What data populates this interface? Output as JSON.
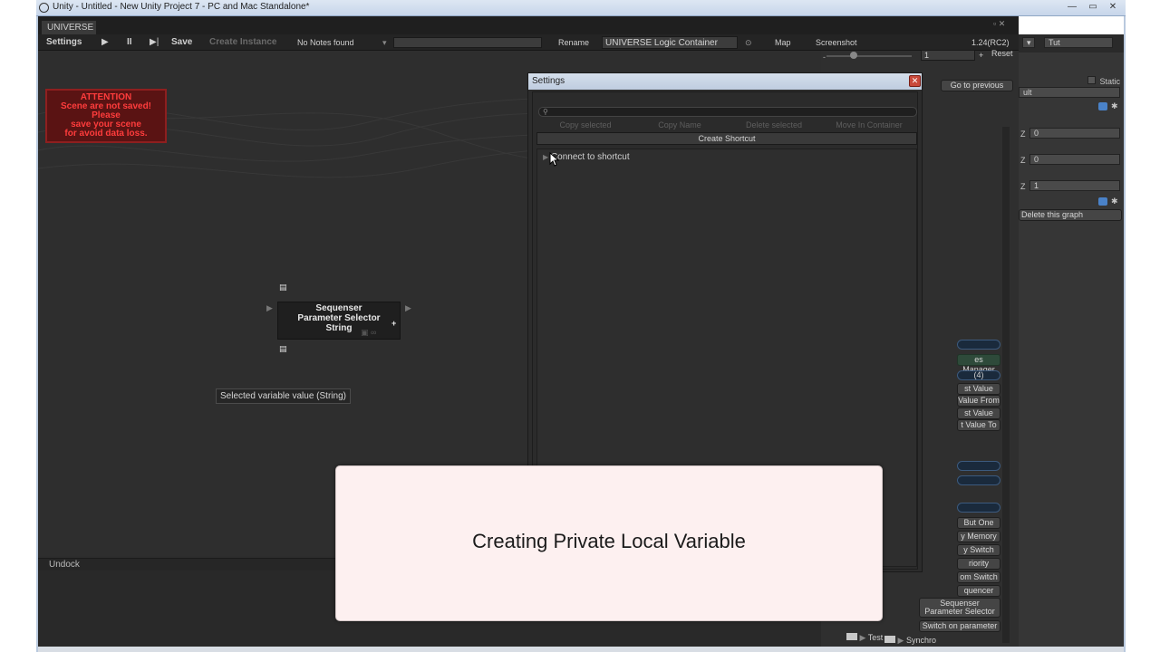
{
  "window": {
    "title": "Unity - Untitled - New Unity Project 7 - PC and Mac Standalone*",
    "controls": {
      "minimize": "—",
      "maximize": "▭",
      "close": "✕"
    }
  },
  "universe": {
    "tab": "UNIVERSE",
    "toolbar": {
      "settings": "Settings",
      "play": "▶",
      "pause": "II",
      "step": "▶|",
      "save": "Save",
      "create_instance": "Create Instance",
      "notes": "No Notes found",
      "rename": "Rename",
      "container_name": "UNIVERSE Logic Container",
      "map": "Map",
      "screenshot": "Screenshot",
      "version": "1.24(RC2)"
    },
    "attention": [
      "ATTENTION",
      "Scene are not saved!",
      "Please",
      "save your scene",
      "for avoid data loss."
    ],
    "node": {
      "line1": "Sequenser",
      "line2": "Parameter Selector",
      "line3": "String"
    },
    "tooltip": "Selected variable value (String)",
    "undock": "Undock"
  },
  "right_panel": {
    "zoom_value": "1",
    "reset": "Reset",
    "go_previous": "Go to previous",
    "delete_graph": "Delete this graph",
    "buttons": [
      "es Manager",
      "(4)",
      "st Value",
      "Value From",
      "st Value",
      "t Value To",
      "But One",
      "y Memory",
      "y Switch",
      "riority",
      "om Switch",
      "quencer"
    ],
    "seq_button": [
      "Sequenser",
      "Parameter Selector"
    ],
    "switch_param": "Switch on parameter",
    "tree": [
      "Synchro",
      "Test"
    ]
  },
  "inspector": {
    "layout_dropdown": "Tut",
    "static_label": "Static",
    "layer_value": "ult",
    "z_label": "Z",
    "z_values": [
      "0",
      "0",
      "1"
    ]
  },
  "settings": {
    "title": "Settings",
    "close": "✕",
    "search_placeholder": "",
    "actions": [
      "Copy selected",
      "Copy Name",
      "Delete selected",
      "Move In Container"
    ],
    "create_shortcut": "Create Shortcut",
    "connect": "Connect to shortcut"
  },
  "caption": "Creating Private Local Variable",
  "colors": {
    "canvas": "#2e2e2e",
    "attention_text": "#ff3c3c",
    "caption_bg": "#fdf0f0"
  }
}
